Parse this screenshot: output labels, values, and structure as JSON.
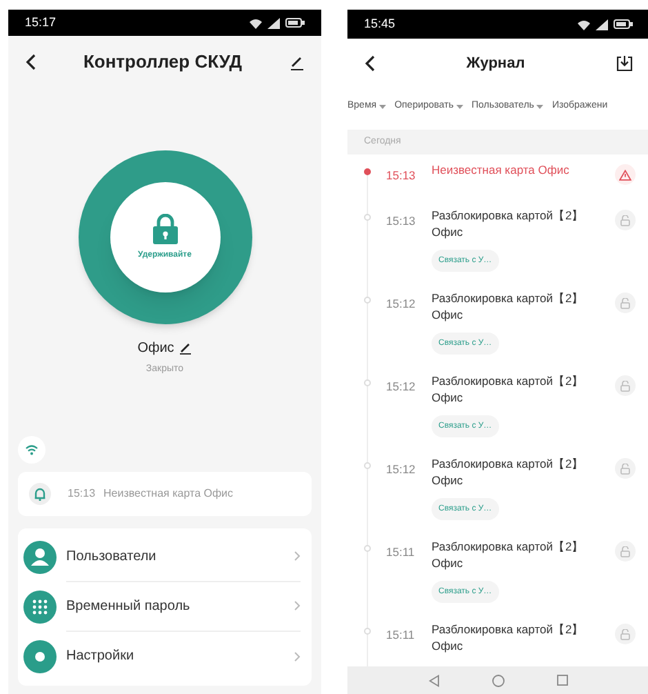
{
  "controller_screen": {
    "status_bar": {
      "time": "15:17"
    },
    "title": "Контроллер СКУД",
    "lock_button": {
      "label": "Удерживайте"
    },
    "device": {
      "name": "Офис",
      "status": "Закрыто"
    },
    "notification": {
      "time": "15:13",
      "text": "Неизвестная карта Офис"
    },
    "menu": [
      {
        "label": "Пользователи",
        "kind": "users"
      },
      {
        "label": "Временный пароль",
        "kind": "password"
      },
      {
        "label": "Настройки",
        "kind": "settings"
      }
    ]
  },
  "journal_screen": {
    "status_bar": {
      "time": "15:45"
    },
    "title": "Журнал",
    "filters": [
      "Время",
      "Оперировать",
      "Пользователь",
      "Изображени"
    ],
    "section": "Сегодня",
    "entries": [
      {
        "kind": "alert",
        "time": "15:13",
        "text": "Неизвестная карта Офис"
      },
      {
        "kind": "unlock",
        "time": "15:13",
        "text": "Разблокировка картой【2】 Офис",
        "link": "Связать с У…"
      },
      {
        "kind": "unlock",
        "time": "15:12",
        "text": "Разблокировка картой【2】 Офис",
        "link": "Связать с У…"
      },
      {
        "kind": "unlock",
        "time": "15:12",
        "text": "Разблокировка картой【2】 Офис",
        "link": "Связать с У…"
      },
      {
        "kind": "unlock",
        "time": "15:12",
        "text": "Разблокировка картой【2】 Офис",
        "link": "Связать с У…"
      },
      {
        "kind": "unlock",
        "time": "15:11",
        "text": "Разблокировка картой【2】 Офис",
        "link": "Связать с У…"
      },
      {
        "kind": "unlock",
        "time": "15:11",
        "text": "Разблокировка картой【2】 Офис"
      }
    ]
  }
}
